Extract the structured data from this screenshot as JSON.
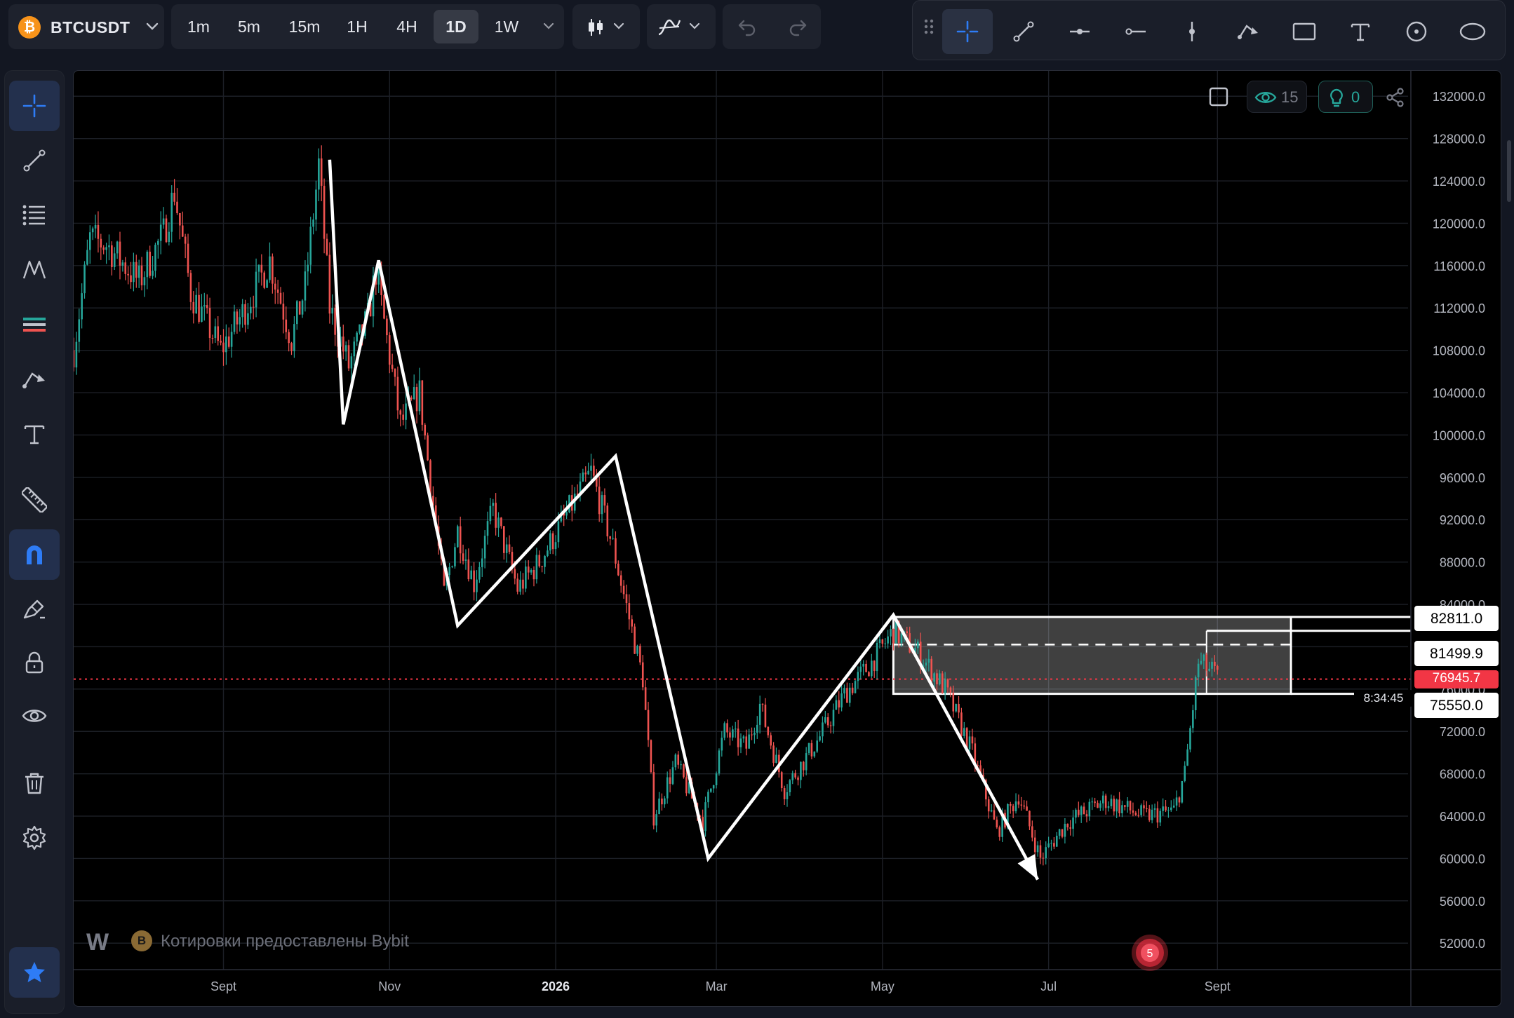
{
  "symbol": {
    "name": "BTCUSDT",
    "coin_letter": "₿",
    "coin_color": "#f7931a"
  },
  "timeframes": [
    {
      "label": "1m",
      "active": false
    },
    {
      "label": "5m",
      "active": false
    },
    {
      "label": "15m",
      "active": false
    },
    {
      "label": "1H",
      "active": false
    },
    {
      "label": "4H",
      "active": false
    },
    {
      "label": "1D",
      "active": true
    },
    {
      "label": "1W",
      "active": false
    }
  ],
  "drawing_toolbar": {
    "tools": [
      "crosshair-icon",
      "trendline-icon",
      "horizontal-line-icon",
      "horizontal-ray-icon",
      "vertical-line-icon",
      "path-icon",
      "rectangle-icon",
      "text-icon",
      "circle-icon",
      "ellipse-icon"
    ],
    "active_tool": "crosshair-icon"
  },
  "sidebar": {
    "items": [
      "crosshair-icon",
      "trendline-icon",
      "fib-retracement-icon",
      "pattern-icon",
      "channel-icon",
      "path-icon",
      "text-icon",
      "ruler-icon",
      "magnet-icon",
      "brush-icon",
      "lock-icon",
      "eye-icon",
      "trash-icon",
      "gear-icon",
      "favorites-star-icon"
    ],
    "active": [
      "crosshair-icon",
      "magnet-icon",
      "favorites-star-icon"
    ]
  },
  "overlay": {
    "watchers_count": "15",
    "ideas_count": "0"
  },
  "watermark": {
    "logo_text": "W",
    "coin_letter": "B",
    "text": "Котировки предоставлены Bybit"
  },
  "alert_badge_count": "5",
  "price_labels": {
    "upper": "82811.0",
    "mid": "81499.9",
    "current": "76945.7",
    "countdown": "8:34:45",
    "lower": "75550.0"
  },
  "colors": {
    "up": "#26a69a",
    "down": "#ef5350",
    "accent": "#2962ff",
    "current_price": "#f23645"
  },
  "chart_data": {
    "type": "candlestick",
    "y_axis": {
      "ticks": [
        52000.0,
        56000.0,
        60000.0,
        64000.0,
        68000.0,
        72000.0,
        76000.0,
        80000.0,
        84000.0,
        88000.0,
        92000.0,
        96000.0,
        100000.0,
        104000.0,
        108000.0,
        112000.0,
        116000.0,
        120000.0,
        124000.0,
        128000.0,
        132000.0
      ],
      "tick_labels": [
        "52000.0",
        "56000.0",
        "60000.0",
        "64000.0",
        "68000.0",
        "72000.0",
        "76000.0",
        "80000.0",
        "84000.0",
        "88000.0",
        "92000.0",
        "96000.0",
        "100000.0",
        "104000.0",
        "108000.0",
        "112000.0",
        "116000.0",
        "120000.0",
        "124000.0",
        "128000.0",
        "132000.0"
      ],
      "range": [
        49500,
        134400
      ]
    },
    "x_axis": {
      "range": [
        "2025-07-08",
        "2026-11-10"
      ],
      "ticks": [
        {
          "date": "2025-09-01",
          "label": "Sept"
        },
        {
          "date": "2025-11-01",
          "label": "Nov"
        },
        {
          "date": "2026-01-01",
          "label": "2026"
        },
        {
          "date": "2026-03-01",
          "label": "Mar"
        },
        {
          "date": "2026-05-01",
          "label": "May"
        },
        {
          "date": "2026-07-01",
          "label": "Jul"
        },
        {
          "date": "2026-09-01",
          "label": "Sept"
        }
      ]
    },
    "close_path": [
      [
        "2025-07-08",
        108000
      ],
      [
        "2025-07-14",
        118500
      ],
      [
        "2025-07-20",
        118000
      ],
      [
        "2025-08-01",
        114500
      ],
      [
        "2025-08-10",
        119000
      ],
      [
        "2025-08-14",
        123000
      ],
      [
        "2025-08-20",
        113500
      ],
      [
        "2025-08-31",
        108000
      ],
      [
        "2025-09-08",
        111500
      ],
      [
        "2025-09-18",
        116500
      ],
      [
        "2025-09-26",
        109000
      ],
      [
        "2025-10-01",
        114000
      ],
      [
        "2025-10-06",
        125500
      ],
      [
        "2025-10-10",
        112000
      ],
      [
        "2025-10-17",
        106500
      ],
      [
        "2025-10-24",
        111000
      ],
      [
        "2025-10-27",
        115500
      ],
      [
        "2025-11-05",
        101000
      ],
      [
        "2025-11-12",
        104000
      ],
      [
        "2025-11-21",
        85000
      ],
      [
        "2025-11-26",
        91000
      ],
      [
        "2025-12-02",
        86000
      ],
      [
        "2025-12-09",
        93000
      ],
      [
        "2025-12-18",
        85500
      ],
      [
        "2025-12-26",
        88000
      ],
      [
        "2026-01-05",
        92500
      ],
      [
        "2026-01-14",
        96500
      ],
      [
        "2026-01-22",
        89500
      ],
      [
        "2026-02-02",
        77000
      ],
      [
        "2026-02-06",
        64000
      ],
      [
        "2026-02-14",
        69000
      ],
      [
        "2026-02-24",
        63500
      ],
      [
        "2026-03-04",
        72000
      ],
      [
        "2026-03-12",
        70500
      ],
      [
        "2026-03-17",
        74500
      ],
      [
        "2026-03-26",
        66500
      ],
      [
        "2026-04-08",
        71500
      ],
      [
        "2026-04-17",
        75500
      ],
      [
        "2026-04-27",
        78500
      ],
      [
        "2026-05-05",
        81500
      ],
      [
        "2026-05-14",
        79500
      ],
      [
        "2026-05-24",
        76000
      ],
      [
        "2026-06-03",
        70000
      ],
      [
        "2026-06-12",
        62500
      ],
      [
        "2026-06-20",
        66000
      ],
      [
        "2026-06-28",
        60000
      ],
      [
        "2026-07-08",
        63500
      ],
      [
        "2026-07-22",
        65500
      ],
      [
        "2026-08-05",
        64000
      ],
      [
        "2026-08-16",
        64500
      ],
      [
        "2026-08-20",
        68000
      ],
      [
        "2026-08-25",
        78500
      ],
      [
        "2026-08-31",
        77500
      ],
      [
        "2026-09-01",
        76945.7
      ]
    ],
    "zigzag_drawing": [
      [
        "2025-10-10",
        126000
      ],
      [
        "2025-10-15",
        101000
      ],
      [
        "2025-10-28",
        116500
      ],
      [
        "2025-11-26",
        82000
      ],
      [
        "2026-01-23",
        98000
      ],
      [
        "2026-02-26",
        60000
      ],
      [
        "2026-05-05",
        83000
      ],
      [
        "2026-06-27",
        58000
      ]
    ],
    "rectangle_zone": {
      "from": "2026-05-05",
      "to": "2026-09-28",
      "top": 82811.0,
      "bottom": 75550.0,
      "midline": 80200
    },
    "horizontal_ray_mid": {
      "from": "2026-08-28",
      "price": 81499.9
    },
    "current_price": 76945.7
  }
}
